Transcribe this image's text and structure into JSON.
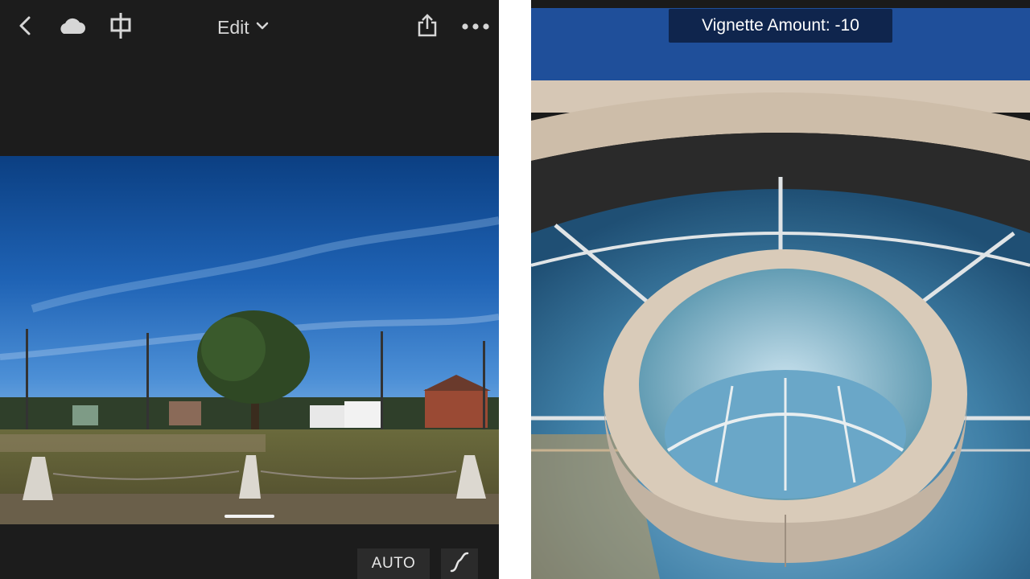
{
  "topbar": {
    "back_icon": "chevron-left-icon",
    "cloud_icon": "cloud-icon",
    "crop_icon": "crop-icon",
    "edit_label": "Edit",
    "dropdown_icon": "chevron-down-icon",
    "share_icon": "share-icon",
    "more_icon": "more-icon"
  },
  "bottom_bar": {
    "auto_label": "AUTO",
    "curve_icon": "tone-curve-icon"
  },
  "right_panel": {
    "toast_text": "Vignette Amount: -10"
  },
  "colors": {
    "app_background": "#1c1c1c",
    "toolbar_button": "#2b2b2b",
    "toast_background": "#0e2246",
    "icon_color": "#d6d6d6"
  }
}
